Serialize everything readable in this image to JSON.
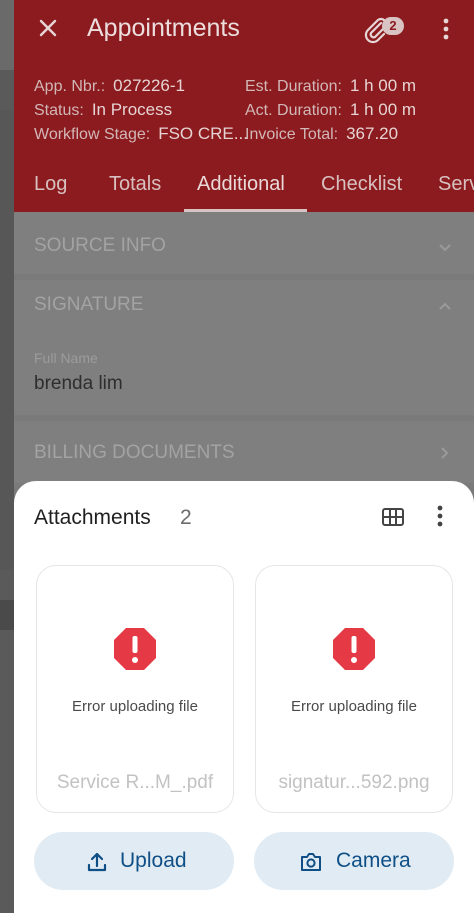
{
  "header": {
    "title": "Appointments",
    "attachment_badge": "2",
    "info": {
      "app_nbr_label": "App. Nbr.:",
      "app_nbr": "027226-1",
      "status_label": "Status:",
      "status": "In Process",
      "workflow_label": "Workflow Stage:",
      "workflow": "FSO CRE...",
      "est_label": "Est. Duration:",
      "est": "1 h 00 m",
      "act_label": "Act. Duration:",
      "act": "1 h 00 m",
      "invoice_label": "Invoice Total:",
      "invoice": "367.20"
    },
    "tabs": [
      "Log",
      "Totals",
      "Additional",
      "Checklist",
      "Serv"
    ],
    "active_tab": "Additional"
  },
  "sections": {
    "source_info": "SOURCE INFO",
    "signature": "SIGNATURE",
    "full_name_label": "Full Name",
    "full_name_value": "brenda lim",
    "billing_documents": "BILLING DOCUMENTS"
  },
  "sheet": {
    "title": "Attachments",
    "count": "2",
    "files": [
      {
        "error": "Error uploading file",
        "name": "Service R...M_.pdf"
      },
      {
        "error": "Error uploading file",
        "name": "signatur...592.png"
      }
    ],
    "upload_label": "Upload",
    "camera_label": "Camera"
  },
  "colors": {
    "header_bg": "#8c1b1f",
    "error_red": "#e53945",
    "button_bg": "#e1ebf3",
    "button_text": "#0f4f86"
  },
  "icons": [
    "close-icon",
    "paperclip-icon",
    "more-vert-icon",
    "chevron-down-icon",
    "chevron-up-icon",
    "chevron-right-icon",
    "grid-view-icon",
    "error-octagon-icon",
    "upload-icon",
    "camera-icon"
  ]
}
